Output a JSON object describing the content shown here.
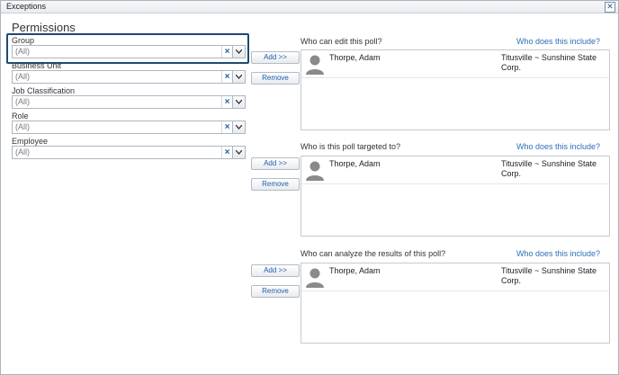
{
  "window": {
    "title": "Exceptions"
  },
  "heading": "Permissions",
  "filters": [
    {
      "label": "Group",
      "value": "(All)"
    },
    {
      "label": "Business Unit",
      "value": "(All)"
    },
    {
      "label": "Job Classification",
      "value": "(All)"
    },
    {
      "label": "Role",
      "value": "(All)"
    },
    {
      "label": "Employee",
      "value": "(All)"
    }
  ],
  "combo": {
    "clear_glyph": "×"
  },
  "buttons": {
    "add": "Add >>",
    "remove": "Remove"
  },
  "sections": [
    {
      "label": "Who can edit this poll?",
      "link": "Who does this include?",
      "person": {
        "name": "Thorpe, Adam",
        "org": "Titusville ~ Sunshine State Corp."
      }
    },
    {
      "label": "Who is this poll targeted to?",
      "link": "Who does this include?",
      "person": {
        "name": "Thorpe, Adam",
        "org": "Titusville ~ Sunshine State Corp."
      }
    },
    {
      "label": "Who can analyze the results of this poll?",
      "link": "Who does this include?",
      "person": {
        "name": "Thorpe, Adam",
        "org": "Titusville ~ Sunshine State Corp."
      }
    }
  ],
  "icons": {
    "close": "close-icon",
    "avatar": "user-avatar-icon",
    "dropdown": "chevron-down-icon"
  },
  "colors": {
    "accent": "#2d6fb7",
    "highlight_border": "#1e4a72"
  }
}
